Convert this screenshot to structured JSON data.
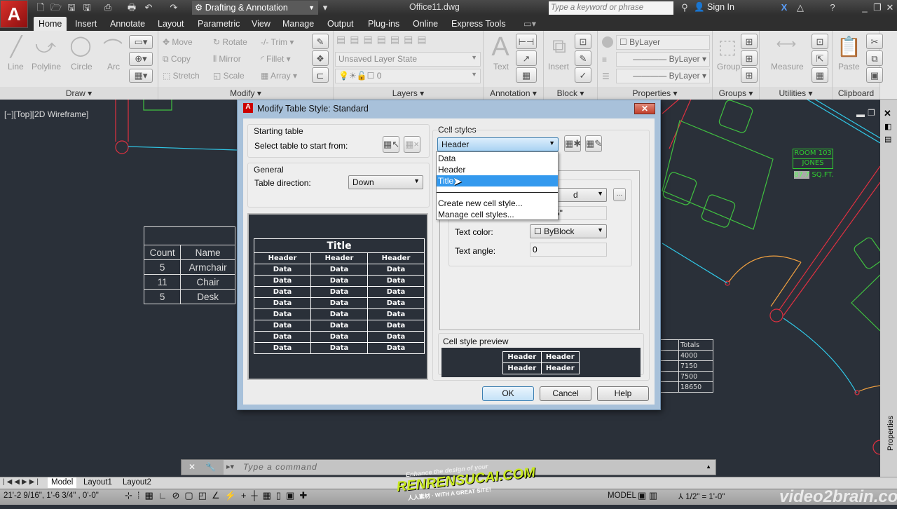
{
  "app": {
    "logo": "A",
    "workspace": "Drafting & Annotation",
    "filename": "Office11.dwg",
    "search_placeholder": "Type a keyword or phrase",
    "sign_in": "Sign In"
  },
  "tabs": [
    "Home",
    "Insert",
    "Annotate",
    "Layout",
    "Parametric",
    "View",
    "Manage",
    "Output",
    "Plug-ins",
    "Online",
    "Express Tools"
  ],
  "ribbon": {
    "draw": {
      "label": "Draw",
      "tools": [
        "Line",
        "Polyline",
        "Circle",
        "Arc"
      ]
    },
    "modify": {
      "label": "Modify",
      "tools": [
        "Move",
        "Rotate",
        "Trim",
        "Copy",
        "Mirror",
        "Fillet",
        "Stretch",
        "Scale",
        "Array"
      ]
    },
    "layers": {
      "label": "Layers",
      "layer_state": "Unsaved Layer State",
      "current_layer": "0"
    },
    "annotation": {
      "label": "Annotation",
      "text": "Text"
    },
    "block": {
      "label": "Block",
      "insert": "Insert"
    },
    "properties": {
      "label": "Properties",
      "color": "ByLayer",
      "linetype": "ByLayer",
      "lineweight": "ByLayer"
    },
    "groups": {
      "label": "Groups",
      "group": "Group"
    },
    "utilities": {
      "label": "Utilities",
      "measure": "Measure"
    },
    "clipboard": {
      "label": "Clipboard",
      "paste": "Paste"
    }
  },
  "viewport": {
    "label": "[−][Top][2D Wireframe]"
  },
  "drawing": {
    "room_table": {
      "headers": [
        "Count",
        "Name"
      ],
      "rows": [
        [
          "5",
          "Armchair"
        ],
        [
          "11",
          "Chair"
        ],
        [
          "5",
          "Desk"
        ]
      ]
    },
    "room_tag": {
      "room": "ROOM 103",
      "name": "JONES",
      "area": "87.7",
      "unit": "SQ.FT."
    },
    "totals_table": {
      "header": "Totals",
      "values": [
        "4000",
        "7150",
        "7500",
        "18650"
      ]
    }
  },
  "dialog": {
    "title": "Modify Table Style: Standard",
    "starting_table": {
      "label": "Starting table",
      "prompt": "Select table to start from:"
    },
    "general": {
      "label": "General",
      "direction_label": "Table direction:",
      "direction_value": "Down"
    },
    "preview": {
      "title": "Title",
      "header": "Header",
      "data": "Data"
    },
    "cell_styles": {
      "label": "Cell styles",
      "selected": "Header",
      "options": [
        "Data",
        "Header",
        "Title"
      ],
      "actions": [
        "Create new cell style...",
        "Manage cell styles..."
      ],
      "highlighted": "Title"
    },
    "text": {
      "style_partial": "d",
      "height_partial": "5\"",
      "color_label": "Text color:",
      "color_value": "ByBlock",
      "angle_label": "Text angle:",
      "angle_value": "0",
      "more": "..."
    },
    "cell_preview": {
      "label": "Cell style preview",
      "cell": "Header"
    },
    "buttons": {
      "ok": "OK",
      "cancel": "Cancel",
      "help": "Help"
    }
  },
  "command": {
    "placeholder": "Type a command"
  },
  "layout_tabs": [
    "Model",
    "Layout1",
    "Layout2"
  ],
  "status": {
    "coords": "21'-2 9/16\", 1'-6 3/4\"  , 0'-0\"",
    "space": "MODEL",
    "scale": "1/2\" = 1'-0\""
  },
  "side_panel": {
    "label": "Properties"
  },
  "watermarks": {
    "renrensucai": "Enhance the design of your RENRENSUCAI.COM WITH A GREAT SITE!",
    "video2brain": "video2brain.com"
  }
}
